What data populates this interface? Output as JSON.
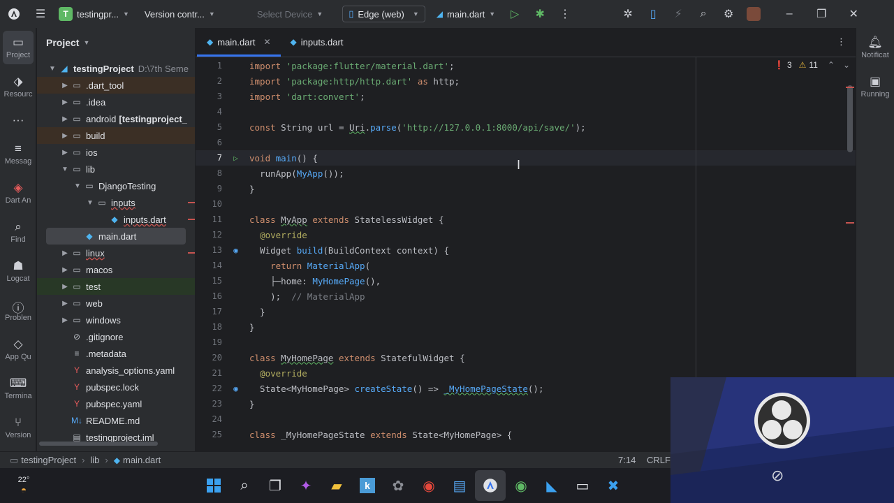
{
  "titlebar": {
    "project_initial": "T",
    "project_name": "testingpr...",
    "vcs": "Version contr...",
    "device_placeholder": "Select Device",
    "browser": "Edge (web)",
    "run_config": "main.dart"
  },
  "toolstrip": [
    {
      "name": "project",
      "label": "Project",
      "icon": "folder-icon"
    },
    {
      "name": "resource",
      "label": "Resourc",
      "icon": "resource-icon"
    },
    {
      "name": "more",
      "label": "",
      "icon": "more-icon"
    },
    {
      "name": "messages",
      "label": "Messag",
      "icon": "messages-icon"
    },
    {
      "name": "dart-analysis",
      "label": "Dart An",
      "icon": "dart-analysis-icon"
    },
    {
      "name": "find",
      "label": "Find",
      "icon": "search-icon"
    },
    {
      "name": "logcat",
      "label": "Logcat",
      "icon": "logcat-icon"
    },
    {
      "name": "problems",
      "label": "Problen",
      "icon": "problems-icon"
    },
    {
      "name": "app-quality",
      "label": "App Qu",
      "icon": "app-quality-icon"
    },
    {
      "name": "terminal",
      "label": "Termina",
      "icon": "terminal-icon"
    },
    {
      "name": "version",
      "label": "Version",
      "icon": "version-control-icon"
    }
  ],
  "project_panel": {
    "title": "Project",
    "root": {
      "name": "testingProject",
      "path": "D:\\7th Seme"
    },
    "items": [
      {
        "label": ".dart_tool",
        "depth": 1,
        "type": "folder",
        "arrow": "▶",
        "excluded": true
      },
      {
        "label": ".idea",
        "depth": 1,
        "type": "folder",
        "arrow": "▶"
      },
      {
        "label": "android",
        "extra": "[testingproject_",
        "depth": 1,
        "type": "folder",
        "arrow": "▶"
      },
      {
        "label": "build",
        "depth": 1,
        "type": "folder",
        "arrow": "▶",
        "excluded": true
      },
      {
        "label": "ios",
        "depth": 1,
        "type": "folder",
        "arrow": "▶"
      },
      {
        "label": "lib",
        "depth": 1,
        "type": "folder",
        "arrow": "▼"
      },
      {
        "label": "DjangoTesting",
        "depth": 2,
        "type": "folder",
        "arrow": "▼"
      },
      {
        "label": "inputs",
        "depth": 3,
        "type": "folder",
        "arrow": "▼",
        "error": true
      },
      {
        "label": "inputs.dart",
        "depth": 4,
        "type": "dart",
        "arrow": "",
        "error": true
      },
      {
        "label": "main.dart",
        "depth": 2,
        "type": "dart",
        "arrow": "",
        "selected": true
      },
      {
        "label": "linux",
        "depth": 1,
        "type": "folder",
        "arrow": "▶",
        "error": true
      },
      {
        "label": "macos",
        "depth": 1,
        "type": "folder",
        "arrow": "▶"
      },
      {
        "label": "test",
        "depth": 1,
        "type": "folder",
        "arrow": "▶",
        "test": true
      },
      {
        "label": "web",
        "depth": 1,
        "type": "folder",
        "arrow": "▶"
      },
      {
        "label": "windows",
        "depth": 1,
        "type": "folder",
        "arrow": "▶"
      },
      {
        "label": ".gitignore",
        "depth": 1,
        "type": "file",
        "arrow": ""
      },
      {
        "label": ".metadata",
        "depth": 1,
        "type": "meta",
        "arrow": ""
      },
      {
        "label": "analysis_options.yaml",
        "depth": 1,
        "type": "yaml",
        "arrow": ""
      },
      {
        "label": "pubspec.lock",
        "depth": 1,
        "type": "yaml",
        "arrow": ""
      },
      {
        "label": "pubspec.yaml",
        "depth": 1,
        "type": "yaml",
        "arrow": ""
      },
      {
        "label": "README.md",
        "depth": 1,
        "type": "md",
        "arrow": ""
      },
      {
        "label": "testingproject.iml",
        "depth": 1,
        "type": "iml",
        "arrow": ""
      }
    ]
  },
  "editor": {
    "tabs": [
      {
        "label": "main.dart",
        "active": true
      },
      {
        "label": "inputs.dart",
        "active": false
      }
    ],
    "inspections": {
      "errors": "3",
      "warnings": "11"
    },
    "current_line": 7
  },
  "code_lines": [
    {
      "n": "1",
      "html": "<span class=\"kw\">import</span> <span class=\"str\">'package:flutter/material.dart'</span>;"
    },
    {
      "n": "2",
      "html": "<span class=\"kw\">import</span> <span class=\"str\">'package:http/http.dart'</span> <span class=\"kw\">as</span> http;"
    },
    {
      "n": "3",
      "html": "<span class=\"kw\">import</span> <span class=\"str\">'dart:convert'</span>;"
    },
    {
      "n": "4",
      "html": ""
    },
    {
      "n": "5",
      "html": "<span class=\"kw\">const</span> String url = <span class=\"ul\">Uri</span>.<span class=\"fn\">parse</span>(<span class=\"str\">'http://127.0.0.1:8000/api/save/'</span>);"
    },
    {
      "n": "6",
      "html": ""
    },
    {
      "n": "7",
      "html": "<span class=\"kw\">void</span> <span class=\"fn\">main</span>() {",
      "gutter": "run"
    },
    {
      "n": "8",
      "html": "  runApp(<span class=\"cls\">MyApp</span>());"
    },
    {
      "n": "9",
      "html": "}"
    },
    {
      "n": "10",
      "html": ""
    },
    {
      "n": "11",
      "html": "<span class=\"kw\">class</span> <span class=\"ul\">MyApp</span> <span class=\"kw\">extends</span> StatelessWidget {"
    },
    {
      "n": "12",
      "html": "  <span class=\"ann\">@override</span>"
    },
    {
      "n": "13",
      "html": "  Widget <span class=\"fn\">build</span>(BuildContext context) {",
      "gutter": "ovr"
    },
    {
      "n": "14",
      "html": "    <span class=\"kw\">return</span> <span class=\"cls\">MaterialApp</span>("
    },
    {
      "n": "15",
      "html": "    ├─home: <span class=\"cls\">MyHomePage</span>(),"
    },
    {
      "n": "16",
      "html": "    );  <span class=\"cmt\">// MaterialApp</span>"
    },
    {
      "n": "17",
      "html": "  }"
    },
    {
      "n": "18",
      "html": "}"
    },
    {
      "n": "19",
      "html": ""
    },
    {
      "n": "20",
      "html": "<span class=\"kw\">class</span> <span class=\"ul\">MyHomePage</span> <span class=\"kw\">extends</span> StatefulWidget {"
    },
    {
      "n": "21",
      "html": "  <span class=\"ann\">@override</span>"
    },
    {
      "n": "22",
      "html": "  State&lt;MyHomePage&gt; <span class=\"fn\">createState</span>() =&gt; <span class=\"cls ul\">_MyHomePageState</span>();",
      "gutter": "ovr"
    },
    {
      "n": "23",
      "html": "}"
    },
    {
      "n": "24",
      "html": ""
    },
    {
      "n": "25",
      "html": "<span class=\"kw\">class</span> _MyHomePageState <span class=\"kw\">extends</span> State&lt;MyHomePage&gt; {"
    }
  ],
  "rightstrip": [
    {
      "label": "Notificat",
      "icon": "bell-icon"
    },
    {
      "label": "Running",
      "icon": "running-devices-icon"
    }
  ],
  "statusbar": {
    "crumbs": [
      "testingProject",
      "lib",
      "main.dart"
    ],
    "position": "7:14",
    "line_ending": "CRLF"
  },
  "taskbar": {
    "weather": "22°",
    "apps": [
      "start-icon",
      "search-icon",
      "task-view-icon",
      "copilot-icon",
      "file-explorer-icon",
      "kite-icon",
      "openai-icon",
      "chrome-icon",
      "notepad-icon",
      "android-studio-icon",
      "chrome-profile-icon",
      "vscode-icon",
      "terminal-icon",
      "remote-icon"
    ]
  },
  "colors": {
    "accent": "#3574f0",
    "error": "#e55b5b",
    "warning": "#e0b23c",
    "run": "#5fb865"
  }
}
